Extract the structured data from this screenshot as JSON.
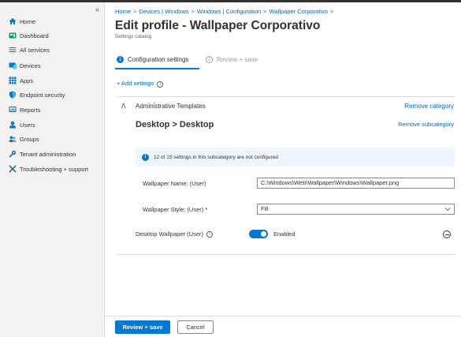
{
  "sidebar": {
    "collapse_glyph": "«",
    "items": [
      {
        "label": "Home",
        "icon": "home-icon",
        "color": "#0078d4"
      },
      {
        "label": "Dashboard",
        "icon": "dashboard-icon",
        "color": "#00a36b"
      },
      {
        "label": "All services",
        "icon": "all-services-icon",
        "color": "#605e5c"
      },
      {
        "label": "Devices",
        "icon": "devices-icon",
        "color": "#0078d4"
      },
      {
        "label": "Apps",
        "icon": "apps-icon",
        "color": "#0078d4"
      },
      {
        "label": "Endpoint security",
        "icon": "shield-icon",
        "color": "#0078d4"
      },
      {
        "label": "Reports",
        "icon": "reports-icon",
        "color": "#0078d4"
      },
      {
        "label": "Users",
        "icon": "user-icon",
        "color": "#0078d4"
      },
      {
        "label": "Groups",
        "icon": "groups-icon",
        "color": "#0078d4"
      },
      {
        "label": "Tenant administration",
        "icon": "tenant-admin-icon",
        "color": "#0078d4"
      },
      {
        "label": "Troubleshooting + support",
        "icon": "troubleshoot-icon",
        "color": "#0078d4"
      }
    ]
  },
  "breadcrumb": {
    "items": [
      "Home",
      "Devices | Windows",
      "Windows | Configuration",
      "Wallpaper Corporativo"
    ],
    "separator": ">"
  },
  "header": {
    "title": "Edit profile - Wallpaper Corporativo",
    "more_glyph": "···",
    "subtitle": "Settings catalog"
  },
  "wizard": {
    "steps": [
      {
        "number": "1",
        "label": "Configuration settings",
        "active": true
      },
      {
        "number": "2",
        "label": "Review + save",
        "active": false
      }
    ]
  },
  "add_settings_label": "+ Add settings",
  "category": {
    "chevron": "ᐱ",
    "name": "Administrative Templates",
    "remove_label": "Remove category",
    "subcategory": "Desktop > Desktop",
    "remove_sub_label": "Remove subcategory",
    "info_text": "12 of 15 settings in this subcategory are not configured"
  },
  "settings": {
    "wallpaper_name_label": "Wallpaper Name: (User)",
    "wallpaper_name_value": "C:\\Windows\\Web\\Wallpaper\\Windows\\Wallpaper.png",
    "wallpaper_style_label": "Wallpaper Style: (User) *",
    "wallpaper_style_value": "Fill",
    "desktop_wallpaper_label": "Desktop Wallpaper (User)",
    "desktop_wallpaper_state": "Enabled"
  },
  "footer": {
    "primary_label": "Review + save",
    "secondary_label": "Cancel"
  },
  "colors": {
    "accent": "#0078d4",
    "link": "#0067b8",
    "sidebar_bg": "#f3f2f1",
    "info_bg": "#f0f6ff"
  }
}
